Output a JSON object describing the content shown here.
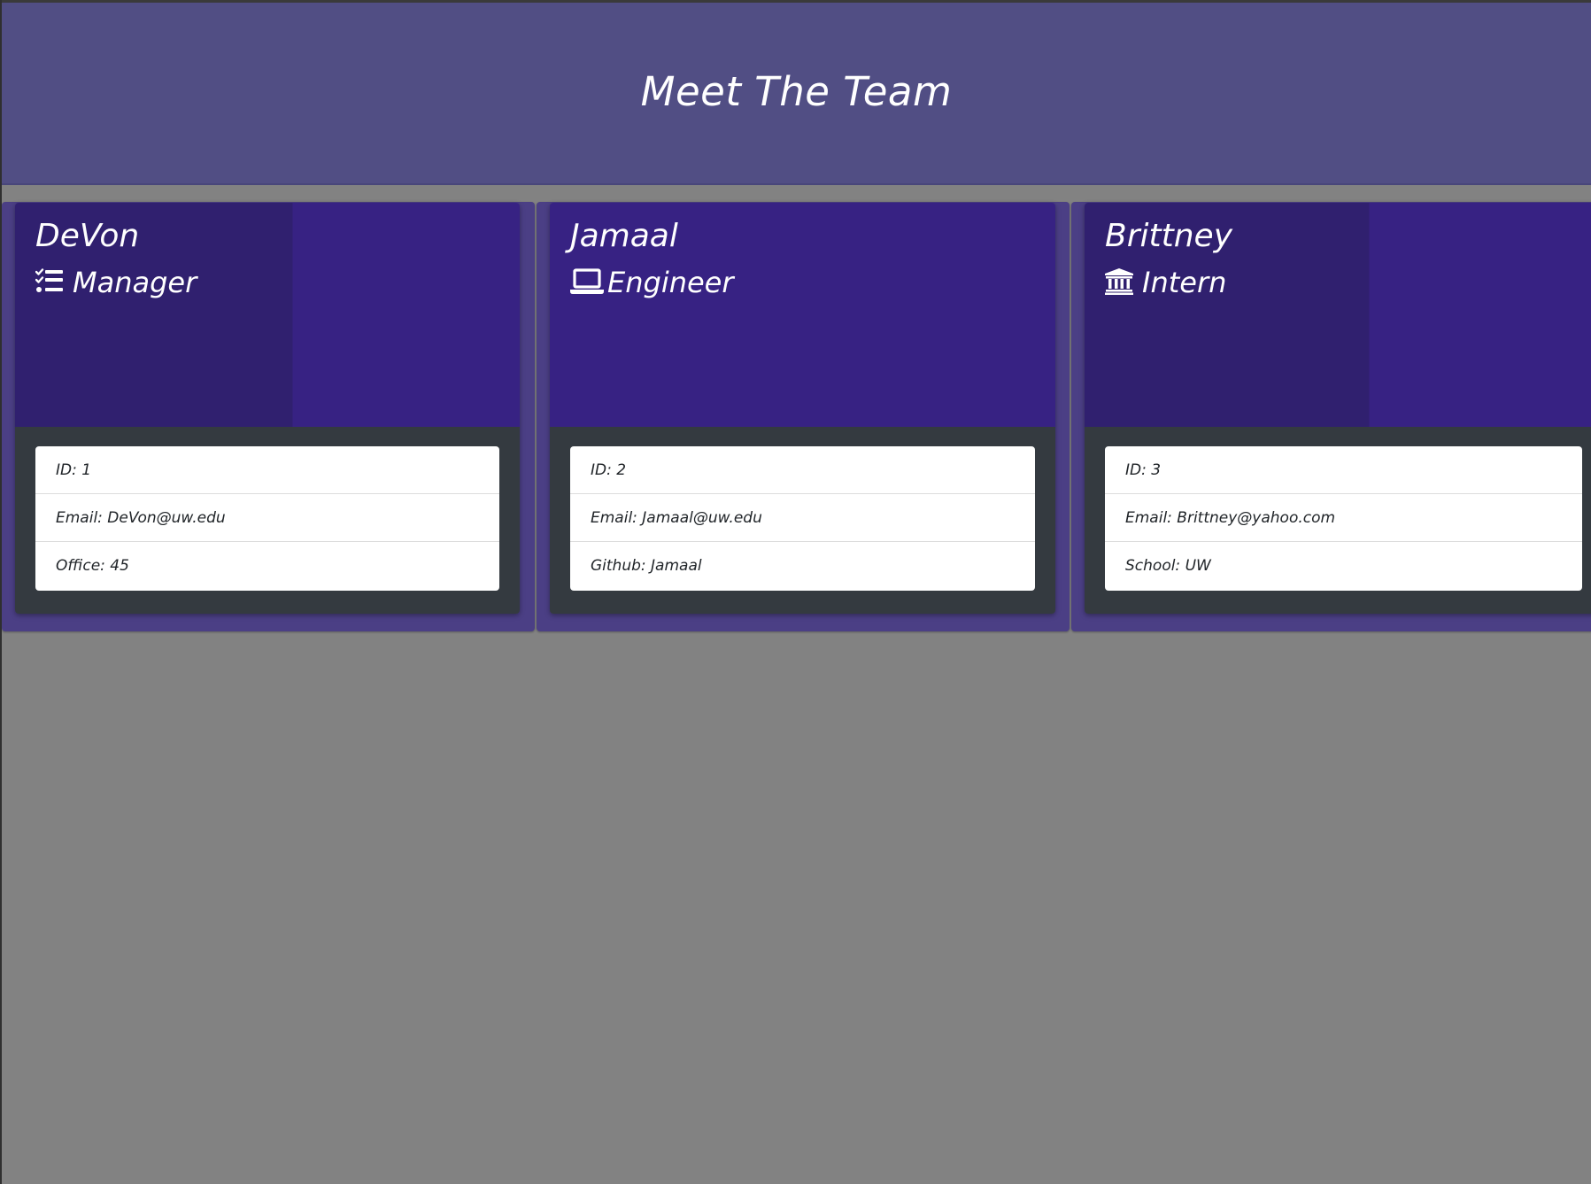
{
  "header": {
    "title": "Meet The Team"
  },
  "team": [
    {
      "name": "DeVon",
      "role": "Manager",
      "role_icon": "tasks-icon",
      "details": [
        "ID: 1",
        "Email: DeVon@uw.edu",
        "Office: 45"
      ]
    },
    {
      "name": "Jamaal",
      "role": "Engineer",
      "role_icon": "laptop-icon",
      "details": [
        "ID: 2",
        "Email: Jamaal@uw.edu",
        "Github: Jamaal"
      ]
    },
    {
      "name": "Brittney",
      "role": "Intern",
      "role_icon": "university-icon",
      "details": [
        "ID: 3",
        "Email: Brittney@yahoo.com",
        "School: UW"
      ]
    }
  ],
  "colors": {
    "page_background": "#828282",
    "banner": "#514e84",
    "card_header": "#372283",
    "card_body": "#343a40",
    "column": "#4b3f85",
    "text_light": "#ffffff",
    "text_dark": "#212529"
  }
}
